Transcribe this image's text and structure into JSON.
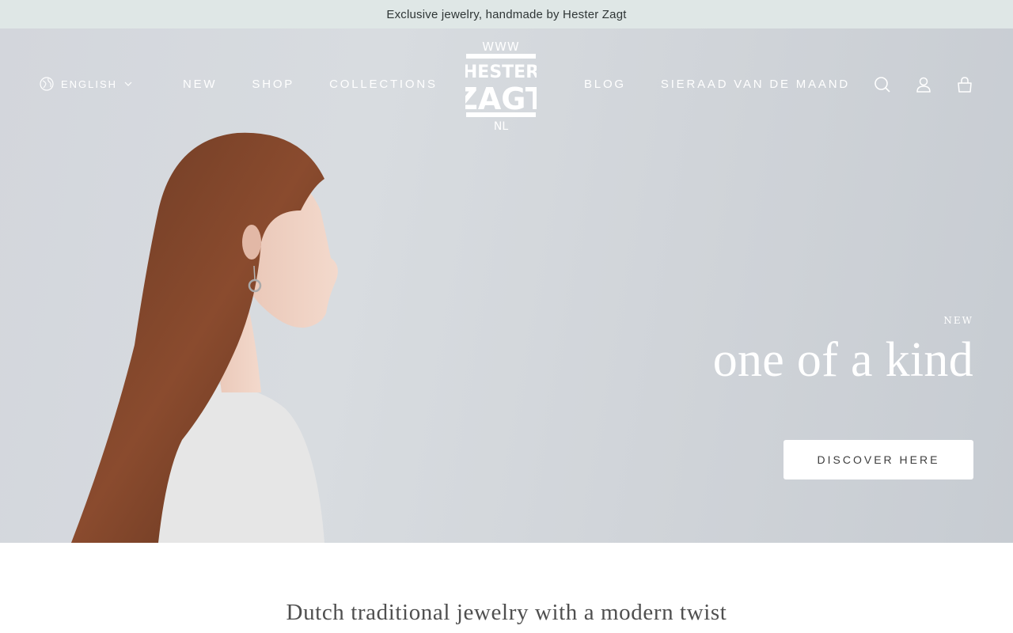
{
  "announcement": "Exclusive jewelry, handmade by Hester Zagt",
  "header": {
    "language": "ENGLISH",
    "nav_left": [
      "NEW",
      "SHOP",
      "COLLECTIONS"
    ],
    "nav_right": [
      "BLOG",
      "SIERAAD VAN DE MAAND"
    ],
    "logo": {
      "line1": "WWW",
      "line2": "HESTER",
      "line3": "ZAGT",
      "line4": "NL"
    },
    "icons": [
      "search-icon",
      "account-icon",
      "cart-icon"
    ]
  },
  "hero": {
    "eyebrow": "NEW",
    "headline": "one of a kind",
    "cta_label": "DISCOVER HERE"
  },
  "tagline": "Dutch traditional jewelry with a modern twist",
  "colors": {
    "announcement_bg": "#dfe7e6",
    "hero_bg": "#d3d6dc",
    "text_white": "#ffffff"
  }
}
